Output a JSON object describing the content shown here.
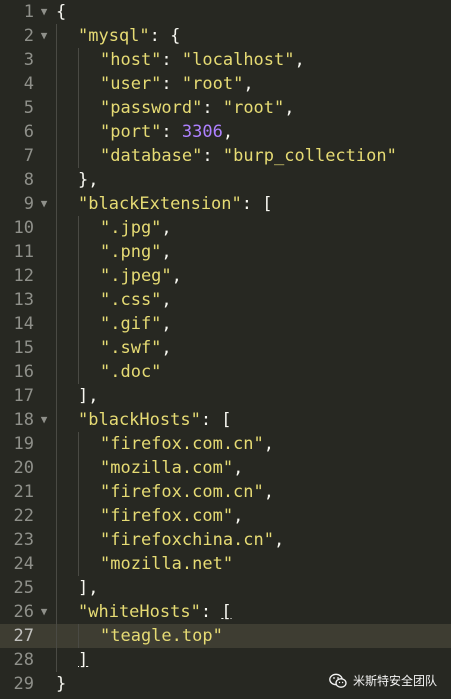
{
  "editor": {
    "active_line": 27,
    "lines": [
      {
        "n": "1",
        "fold": "▼",
        "indent": 0,
        "tokens": [
          {
            "t": "{",
            "c": "punct"
          }
        ]
      },
      {
        "n": "2",
        "fold": "▼",
        "indent": 1,
        "tokens": [
          {
            "t": "\"mysql\"",
            "c": "str"
          },
          {
            "t": ": {",
            "c": "punct"
          }
        ]
      },
      {
        "n": "3",
        "fold": "",
        "indent": 2,
        "tokens": [
          {
            "t": "\"host\"",
            "c": "str"
          },
          {
            "t": ": ",
            "c": "punct"
          },
          {
            "t": "\"localhost\"",
            "c": "str"
          },
          {
            "t": ",",
            "c": "punct"
          }
        ]
      },
      {
        "n": "4",
        "fold": "",
        "indent": 2,
        "tokens": [
          {
            "t": "\"user\"",
            "c": "str"
          },
          {
            "t": ": ",
            "c": "punct"
          },
          {
            "t": "\"root\"",
            "c": "str"
          },
          {
            "t": ",",
            "c": "punct"
          }
        ]
      },
      {
        "n": "5",
        "fold": "",
        "indent": 2,
        "tokens": [
          {
            "t": "\"password\"",
            "c": "str"
          },
          {
            "t": ": ",
            "c": "punct"
          },
          {
            "t": "\"root\"",
            "c": "str"
          },
          {
            "t": ",",
            "c": "punct"
          }
        ]
      },
      {
        "n": "6",
        "fold": "",
        "indent": 2,
        "tokens": [
          {
            "t": "\"port\"",
            "c": "str"
          },
          {
            "t": ": ",
            "c": "punct"
          },
          {
            "t": "3306",
            "c": "num"
          },
          {
            "t": ",",
            "c": "punct"
          }
        ]
      },
      {
        "n": "7",
        "fold": "",
        "indent": 2,
        "tokens": [
          {
            "t": "\"database\"",
            "c": "str"
          },
          {
            "t": ": ",
            "c": "punct"
          },
          {
            "t": "\"burp_collection\"",
            "c": "str"
          }
        ]
      },
      {
        "n": "8",
        "fold": "",
        "indent": 1,
        "tokens": [
          {
            "t": "},",
            "c": "punct"
          }
        ]
      },
      {
        "n": "9",
        "fold": "▼",
        "indent": 1,
        "tokens": [
          {
            "t": "\"blackExtension\"",
            "c": "str"
          },
          {
            "t": ": [",
            "c": "punct"
          }
        ]
      },
      {
        "n": "10",
        "fold": "",
        "indent": 2,
        "tokens": [
          {
            "t": "\".jpg\"",
            "c": "str"
          },
          {
            "t": ",",
            "c": "punct"
          }
        ]
      },
      {
        "n": "11",
        "fold": "",
        "indent": 2,
        "tokens": [
          {
            "t": "\".png\"",
            "c": "str"
          },
          {
            "t": ",",
            "c": "punct"
          }
        ]
      },
      {
        "n": "12",
        "fold": "",
        "indent": 2,
        "tokens": [
          {
            "t": "\".jpeg\"",
            "c": "str"
          },
          {
            "t": ",",
            "c": "punct"
          }
        ]
      },
      {
        "n": "13",
        "fold": "",
        "indent": 2,
        "tokens": [
          {
            "t": "\".css\"",
            "c": "str"
          },
          {
            "t": ",",
            "c": "punct"
          }
        ]
      },
      {
        "n": "14",
        "fold": "",
        "indent": 2,
        "tokens": [
          {
            "t": "\".gif\"",
            "c": "str"
          },
          {
            "t": ",",
            "c": "punct"
          }
        ]
      },
      {
        "n": "15",
        "fold": "",
        "indent": 2,
        "tokens": [
          {
            "t": "\".swf\"",
            "c": "str"
          },
          {
            "t": ",",
            "c": "punct"
          }
        ]
      },
      {
        "n": "16",
        "fold": "",
        "indent": 2,
        "tokens": [
          {
            "t": "\".doc\"",
            "c": "str"
          }
        ]
      },
      {
        "n": "17",
        "fold": "",
        "indent": 1,
        "tokens": [
          {
            "t": "],",
            "c": "punct"
          }
        ]
      },
      {
        "n": "18",
        "fold": "▼",
        "indent": 1,
        "tokens": [
          {
            "t": "\"blackHosts\"",
            "c": "str"
          },
          {
            "t": ": [",
            "c": "punct"
          }
        ]
      },
      {
        "n": "19",
        "fold": "",
        "indent": 2,
        "tokens": [
          {
            "t": "\"firefox.com.cn\"",
            "c": "str"
          },
          {
            "t": ",",
            "c": "punct"
          }
        ]
      },
      {
        "n": "20",
        "fold": "",
        "indent": 2,
        "tokens": [
          {
            "t": "\"mozilla.com\"",
            "c": "str"
          },
          {
            "t": ",",
            "c": "punct"
          }
        ]
      },
      {
        "n": "21",
        "fold": "",
        "indent": 2,
        "tokens": [
          {
            "t": "\"firefox.com.cn\"",
            "c": "str"
          },
          {
            "t": ",",
            "c": "punct"
          }
        ]
      },
      {
        "n": "22",
        "fold": "",
        "indent": 2,
        "tokens": [
          {
            "t": "\"firefox.com\"",
            "c": "str"
          },
          {
            "t": ",",
            "c": "punct"
          }
        ]
      },
      {
        "n": "23",
        "fold": "",
        "indent": 2,
        "tokens": [
          {
            "t": "\"firefoxchina.cn\"",
            "c": "str"
          },
          {
            "t": ",",
            "c": "punct"
          }
        ]
      },
      {
        "n": "24",
        "fold": "",
        "indent": 2,
        "tokens": [
          {
            "t": "\"mozilla.net\"",
            "c": "str"
          }
        ]
      },
      {
        "n": "25",
        "fold": "",
        "indent": 1,
        "tokens": [
          {
            "t": "],",
            "c": "punct"
          }
        ]
      },
      {
        "n": "26",
        "fold": "▼",
        "indent": 1,
        "tokens": [
          {
            "t": "\"whiteHosts\"",
            "c": "str"
          },
          {
            "t": ": ",
            "c": "punct"
          },
          {
            "t": "[",
            "c": "punct",
            "u": true
          }
        ]
      },
      {
        "n": "27",
        "fold": "",
        "indent": 2,
        "tokens": [
          {
            "t": "\"teagle.top\"",
            "c": "str"
          }
        ]
      },
      {
        "n": "28",
        "fold": "",
        "indent": 1,
        "tokens": [
          {
            "t": "]",
            "c": "punct",
            "u": true
          }
        ]
      },
      {
        "n": "29",
        "fold": "",
        "indent": 0,
        "tokens": [
          {
            "t": "}",
            "c": "punct"
          }
        ]
      }
    ]
  },
  "watermark": {
    "text": "米斯特安全团队",
    "icon": "wechat-icon"
  },
  "colors": {
    "background": "#272822",
    "string": "#e6db74",
    "number": "#ae81ff",
    "text": "#f8f8f2",
    "gutter": "#8f908a"
  }
}
